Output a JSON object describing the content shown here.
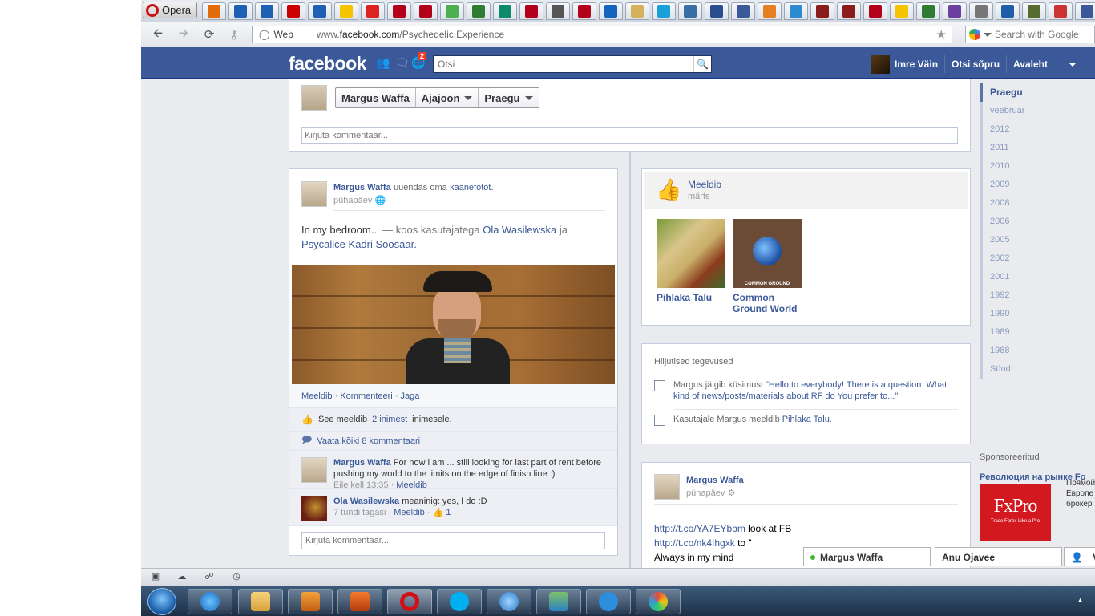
{
  "browser": {
    "opera_label": "Opera",
    "address_scheme_label": "Web",
    "url_prefix": "www.",
    "url_domain": "facebook.com",
    "url_path": "/Psychedelic.Experience",
    "search_placeholder": "Search with Google",
    "tab_favicons": [
      "#e36c0a",
      "#1f5fb4",
      "#1f5fb4",
      "#c00",
      "#1f5fb4",
      "#f5c400",
      "#d22",
      "#b3001b",
      "#b3001b",
      "#4caf50",
      "#2e7d32",
      "#0e8a6b",
      "#b3001b",
      "#555",
      "#b3001b",
      "#1565c0",
      "#d4b25c",
      "#1aa0d8",
      "#3b6ea5",
      "#2a4d8f",
      "#3b5998",
      "#e67e22",
      "#2d8ccf",
      "#8b1c1c",
      "#8b1c1c",
      "#b3001b",
      "#f5c400",
      "#2e7d32",
      "#6d3fa0",
      "#777",
      "#1e5ea8",
      "#556b2f",
      "#cc3333",
      "#3b5998"
    ]
  },
  "fb": {
    "logo": "facebook",
    "notif_count": "2",
    "search_placeholder": "Otsi",
    "user_name": "Imre Väin",
    "find_friends": "Otsi sõpru",
    "home": "Avaleht"
  },
  "timeline_header": {
    "name": "Margus Waffa",
    "timeline": "Ajajoon",
    "now": "Praegu",
    "comment_placeholder": "Kirjuta kommentaar..."
  },
  "post1": {
    "author": "Margus Waffa",
    "action": "uuendas oma",
    "action_link": "kaanefotot.",
    "time": "pühapäev",
    "text": "In my bedroom...",
    "with_text": "— koos kasutajatega",
    "tag1": "Ola Wasilewska",
    "and": "ja",
    "tag2": "Psycalice Kadri Soosaar",
    "period": ".",
    "like": "Meeldib",
    "comment": "Kommenteeri",
    "share": "Jaga",
    "likes_prefix": "See meeldib",
    "likes_link": "2 inimest",
    "likes_suffix": "inimesele.",
    "view_comments": "Vaata kõiki 8 kommentaari",
    "comments": [
      {
        "author": "Margus Waffa",
        "text": "For now i am ... still looking for last part of rent before pushing my world to the limits on the edge of finish line :)",
        "time": "Eile kell 13:35",
        "like": "Meeldib",
        "likes": ""
      },
      {
        "author": "Ola Wasilewska",
        "text": "meaninig: yes, I do :D",
        "time": "7 tundi tagasi",
        "like": "Meeldib",
        "likes": "1"
      }
    ],
    "write_placeholder": "Kirjuta kommentaar..."
  },
  "likes_card": {
    "title": "Meeldib",
    "month": "märts",
    "pages": [
      {
        "name": "Pihlaka Talu"
      },
      {
        "name": "Common Ground World",
        "caption": "COMMON GROUND"
      }
    ]
  },
  "recent": {
    "title": "Hiljutised tegevused",
    "item1_prefix": "Margus jälgib küsimust",
    "item1_link": "\"Hello to everybody! There is a question: What kind of news/posts/materials about RF do You prefer to...\"",
    "item2_prefix": "Kasutajale Margus meeldib",
    "item2_link": "Pihlaka Talu",
    "item2_suffix": "."
  },
  "post2": {
    "author": "Margus Waffa",
    "time": "pühapäev",
    "link1": "http://t.co/YA7EYbbm",
    "after1": " look at FB",
    "link2": "http://t.co/nk4Ihgxk",
    "after2": " to \"",
    "line3": "Always in my mind"
  },
  "years": [
    "Praegu",
    "veebruar",
    "2012",
    "2011",
    "2010",
    "2009",
    "2008",
    "2006",
    "2005",
    "2002",
    "2001",
    "1992",
    "1990",
    "1989",
    "1988",
    "Sünd"
  ],
  "sponsored": {
    "title": "Sponsoreeritud",
    "ad_title": "Революция на рынке Fo",
    "logo_text": "FxPro",
    "logo_sub": "Trade Forex Like a Pro",
    "ad_lines": [
      "Прямой",
      "Европе",
      "брокер"
    ]
  },
  "chat": {
    "tab1": "Margus Waffa",
    "tab2": "Anu Ojavee",
    "tab3": "Ve"
  }
}
